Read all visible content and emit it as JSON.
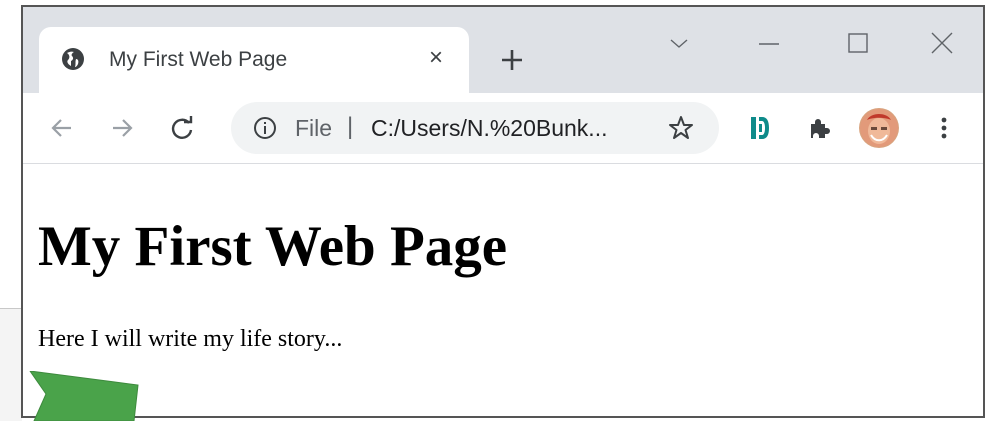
{
  "tab": {
    "title": "My First Web Page",
    "close_glyph": "×",
    "favicon": "globe-icon"
  },
  "titlebar": {
    "new_tab_icon": "plus-icon",
    "window_controls": [
      "chevron-down-icon",
      "minimize-icon",
      "maximize-icon",
      "close-icon"
    ]
  },
  "toolbar": {
    "nav_icons": [
      "back-arrow-icon",
      "forward-arrow-icon",
      "reload-icon"
    ],
    "omnibox": {
      "scheme_label": "File",
      "separator": "|",
      "url": "C:/Users/N.%20Bunk..."
    },
    "extension_icons": [
      "dashlane-icon",
      "puzzle-icon"
    ],
    "menu_icon": "kebab-menu-icon"
  },
  "page": {
    "heading": "My First Web Page",
    "paragraph": "Here I will write my life story..."
  },
  "colors": {
    "titlebar_bg": "#dee1e6",
    "omnibox_bg": "#f1f3f4",
    "accent_green": "#4aa34a",
    "dashlane_teal": "#0e8b8a"
  }
}
